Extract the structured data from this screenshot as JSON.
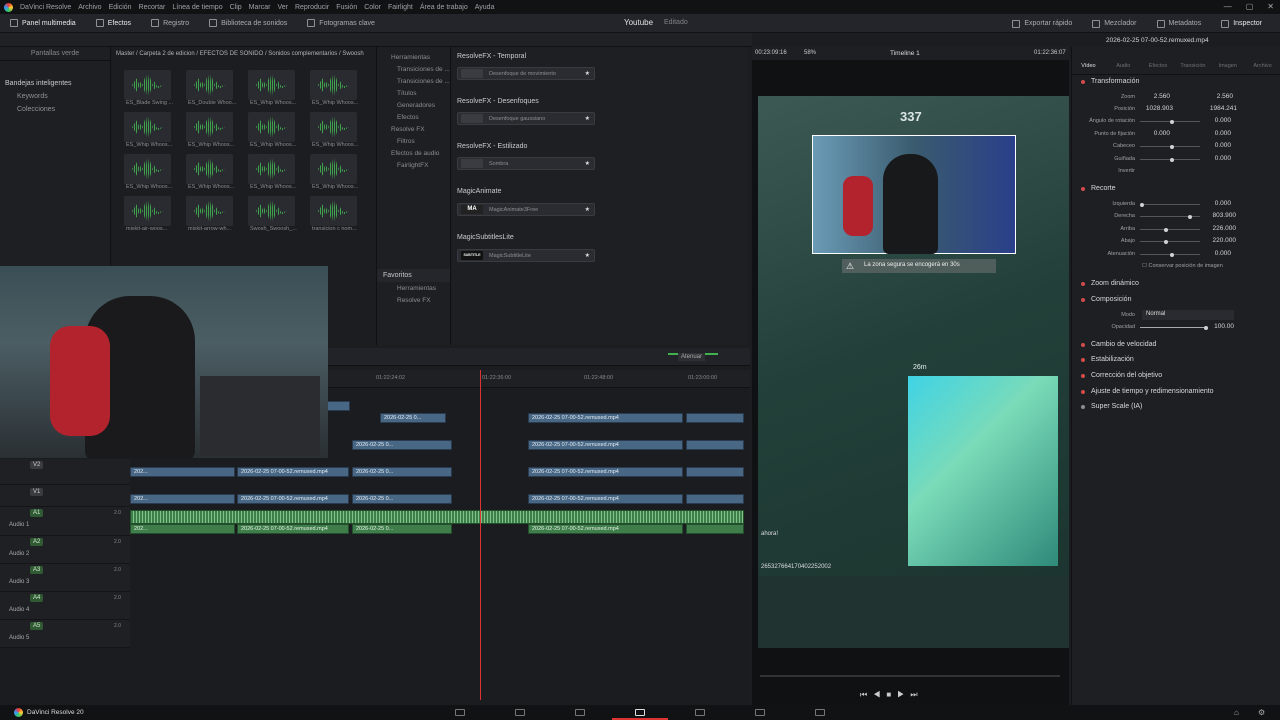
{
  "menu": {
    "app": "DaVinci Resolve",
    "items": [
      "Archivo",
      "Edición",
      "Recortar",
      "Línea de tiempo",
      "Clip",
      "Marcar",
      "Ver",
      "Reproducir",
      "Fusión",
      "Color",
      "Fairlight",
      "Área de trabajo",
      "Ayuda"
    ]
  },
  "toolbar": {
    "media_pool": "Panel multimedia",
    "effects": "Efectos",
    "index": "Registro",
    "sound_library": "Biblioteca de sonidos",
    "keyframes": "Fotogramas clave",
    "project_title": "Youtube",
    "project_status": "Editado",
    "quick_export": "Exportar rápido",
    "mixer": "Mezclador",
    "metadata": "Metadatos",
    "inspector": "Inspector"
  },
  "sidebar": {
    "header": "Pantallas verde",
    "smart_bins": "Bandejas inteligentes",
    "keywords": "Keywords",
    "collections": "Colecciones"
  },
  "breadcrumb": "Master / Carpeta 2 de edicion / EFECTOS DE SONIDO / Sonidos complementarios / Swoosh",
  "sound_clips": [
    "ES_Blade Swing ...",
    "ES_Double Whoo...",
    "ES_Whip Whoos...",
    "ES_Whip Whoos...",
    "ES_Whip Whoos...",
    "ES_Whip Whoos...",
    "ES_Whip Whoos...",
    "ES_Whip Whoos...",
    "ES_Whip Whoos...",
    "ES_Whip Whoos...",
    "ES_Whip Whoos...",
    "ES_Whip Whoos...",
    "mixkit-air-woos...",
    "mixkit-arrow-wh...",
    "Swosh_Swoosh_...",
    "transicion c nom..."
  ],
  "effects_tree": {
    "items": [
      "Herramientas",
      "Transiciones de ...",
      "Transiciones de ...",
      "Títulos",
      "Generadores",
      "Efectos",
      "Resolve FX",
      "Filtros",
      "Efectos de audio",
      "FairlightFX"
    ],
    "favorites": "Favoritos",
    "fav_items": [
      "Herramientas",
      "Resolve FX"
    ]
  },
  "fx_list": [
    {
      "category": "ResolveFX - Temporal",
      "name": "Desenfoque de movimiento",
      "icon": ""
    },
    {
      "category": "ResolveFX - Desenfoques",
      "name": "Desenfoque gaussiano",
      "icon": ""
    },
    {
      "category": "ResolveFX - Estilizado",
      "name": "Sombra",
      "icon": ""
    },
    {
      "category": "MagicAnimate",
      "name": "MagicAnimate3Free",
      "icon": "MA"
    },
    {
      "category": "MagicSubtitlesLite",
      "name": "MagicSubtitleLite",
      "icon": "SUBTITLE"
    }
  ],
  "timeline": {
    "mute_label": "Atenuar",
    "ruler": [
      "01:22:24:02",
      "01:22:36:00",
      "01:22:48:00",
      "01:23:00:00"
    ],
    "video_tracks": [
      "V2",
      "V1"
    ],
    "audio_tracks": [
      {
        "id": "A1",
        "name": "Audio 1",
        "level": "2.0"
      },
      {
        "id": "A2",
        "name": "Audio 2",
        "level": "2.0"
      },
      {
        "id": "A3",
        "name": "Audio 3",
        "level": "2.0"
      },
      {
        "id": "A4",
        "name": "Audio 4",
        "level": "2.0"
      },
      {
        "id": "A5",
        "name": "Audio 5",
        "level": "2.0"
      }
    ],
    "clip_name": "2026-02-25 07-00-52.remuxed.mp4",
    "clip_short": "2026-02-25 0...",
    "clip_tiny": "202..."
  },
  "viewer": {
    "source_tc": "00:23:09:16",
    "zoom": "58%",
    "timeline_name": "Timeline 1",
    "record_tc": "01:22:36:07",
    "safe_zone_msg": "La zona segura se encogerá en 30s",
    "hud_number": "337",
    "hud_distance": "26m",
    "id_text": "265327664170402252002",
    "grab_text": "ahora!"
  },
  "inspector": {
    "clip_name": "2026-02-25 07-00-52.remuxed.mp4",
    "tabs": [
      "Vídeo",
      "Audio",
      "Efectos",
      "Transición",
      "Imagen",
      "Archivo"
    ],
    "transform": {
      "title": "Transformación",
      "zoom_label": "Zoom",
      "zoom_x": "2.560",
      "zoom_y": "2.560",
      "position_label": "Posición",
      "pos_x": "1028.903",
      "pos_y": "1984.241",
      "rotation_label": "Ángulo de rotación",
      "rotation": "0.000",
      "anchor_label": "Punto de fijación",
      "anchor_x": "0.000",
      "anchor_y": "0.000",
      "pitch_label": "Cabeceo",
      "pitch": "0.000",
      "yaw_label": "Guiñada",
      "yaw": "0.000",
      "flip_label": "Invertir"
    },
    "crop": {
      "title": "Recorte",
      "left_label": "Izquierda",
      "left": "0.000",
      "right_label": "Derecha",
      "right": "803.900",
      "top_label": "Arriba",
      "top": "226.000",
      "bottom_label": "Abajo",
      "bottom": "220.000",
      "soft_label": "Atenuación",
      "soft": "0.000",
      "retain": "Conservar posición de imagen"
    },
    "dynamic_zoom": "Zoom dinámico",
    "composite": {
      "title": "Composición",
      "mode_label": "Modo",
      "mode": "Normal",
      "opacity_label": "Opacidad",
      "opacity": "100.00"
    },
    "speed_change": "Cambio de velocidad",
    "stabilization": "Estabilización",
    "lens_correction": "Corrección del objetivo",
    "retime_scaling": "Ajuste de tiempo y redimensionamiento",
    "super_scale": "Super Scale (IA)"
  },
  "bottom": {
    "app_version": "DaVinci Resolve 20"
  },
  "colors": {
    "accent_red": "#d24b4b",
    "video_clip": "#476785",
    "audio_clip": "#3f7d4a"
  }
}
